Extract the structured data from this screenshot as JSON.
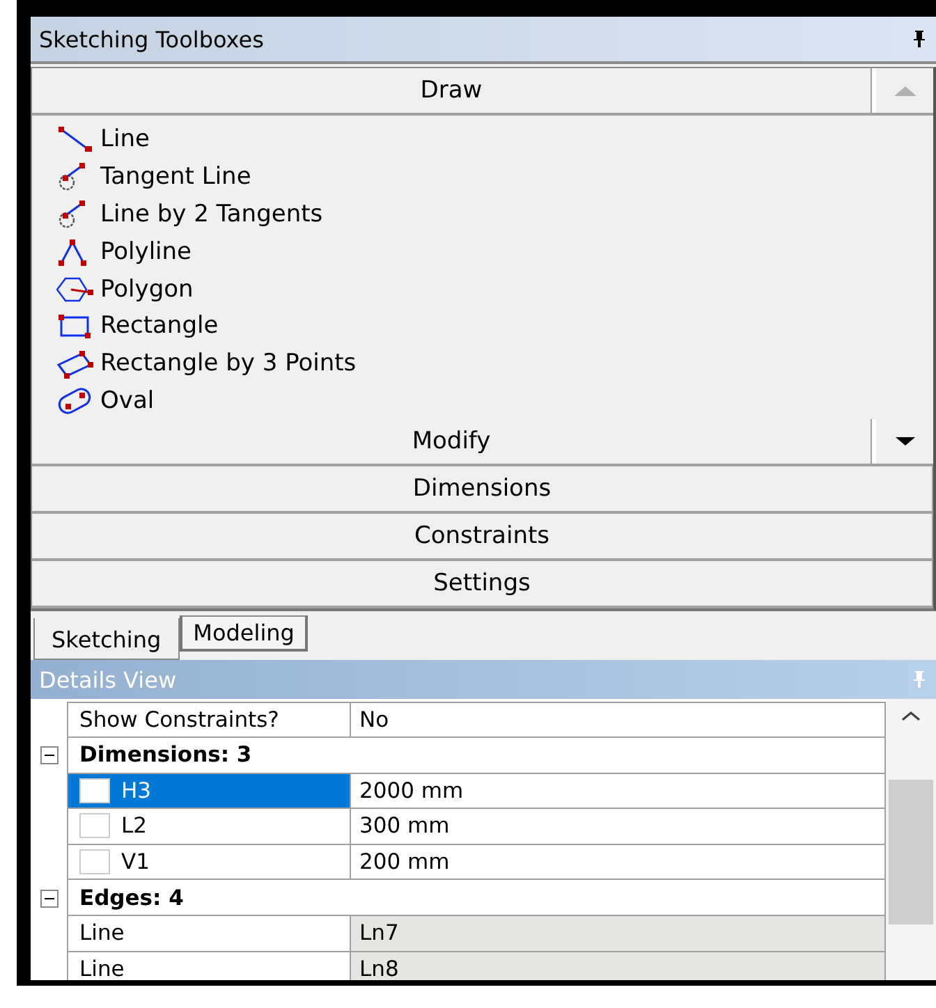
{
  "toolbox": {
    "title": "Sketching Toolboxes",
    "groups": [
      {
        "label": "Draw",
        "kind": "scroll_up",
        "items": [
          {
            "label": "Line",
            "kind": "line"
          },
          {
            "label": "Tangent Line",
            "kind": "tangent"
          },
          {
            "label": "Line by 2 Tangents",
            "kind": "tangent"
          },
          {
            "label": "Polyline",
            "kind": "polyline"
          },
          {
            "label": "Polygon",
            "kind": "polygon"
          },
          {
            "label": "Rectangle",
            "kind": "rectangle"
          },
          {
            "label": "Rectangle by 3 Points",
            "kind": "rect3"
          },
          {
            "label": "Oval",
            "kind": "oval"
          }
        ]
      },
      {
        "label": "Modify",
        "kind": "scroll_down"
      },
      {
        "label": "Dimensions",
        "kind": "plain"
      },
      {
        "label": "Constraints",
        "kind": "plain"
      },
      {
        "label": "Settings",
        "kind": "plain"
      }
    ],
    "tabs": [
      {
        "label": "Sketching",
        "selected": true
      },
      {
        "label": "Modeling",
        "selected": false
      }
    ]
  },
  "details": {
    "title": "Details View",
    "rows": [
      {
        "kind": "property",
        "name": "Show Constraints?",
        "value": "No"
      },
      {
        "kind": "group",
        "label": "Dimensions: 3",
        "expanded": true
      },
      {
        "kind": "dimension",
        "name": "H3",
        "value": "2000 mm",
        "selected": true,
        "checked": false
      },
      {
        "kind": "dimension",
        "name": "L2",
        "value": "300 mm",
        "selected": false,
        "checked": false
      },
      {
        "kind": "dimension",
        "name": "V1",
        "value": "200 mm",
        "selected": false,
        "checked": false
      },
      {
        "kind": "group",
        "label": "Edges: 4",
        "expanded": true
      },
      {
        "kind": "readonly",
        "name": "Line",
        "value": "Ln7"
      },
      {
        "kind": "readonly",
        "name": "Line",
        "value": "Ln8"
      }
    ]
  }
}
